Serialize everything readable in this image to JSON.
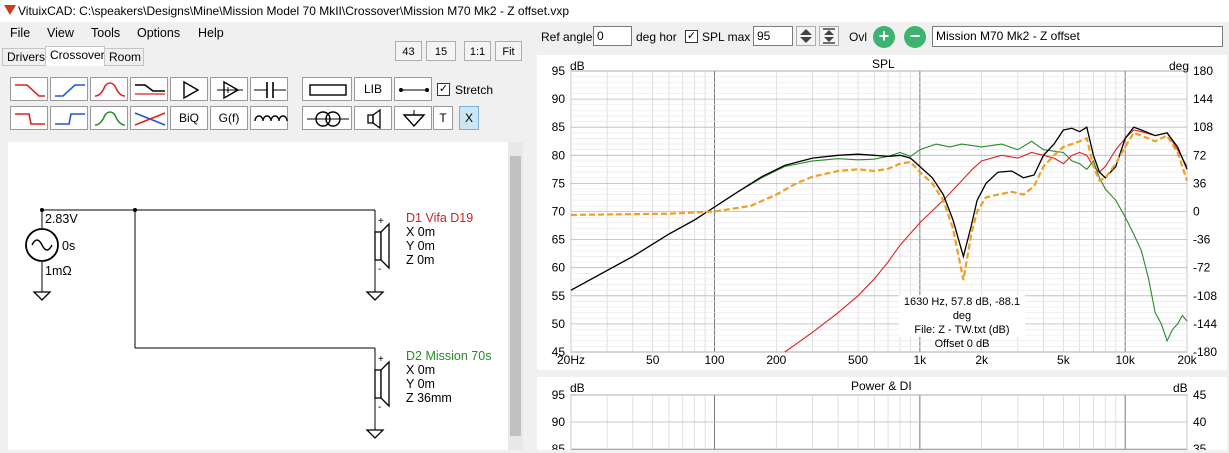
{
  "window": {
    "title": "VituixCAD: C:\\speakers\\Designs\\Mine\\Mission Model 70 MkII\\Crossover\\Mission M70 Mk2 - Z offset.vxp"
  },
  "menu": {
    "file": "File",
    "view": "View",
    "tools": "Tools",
    "options": "Options",
    "help": "Help"
  },
  "zoom_buttons": {
    "b43": "43",
    "b15": "15",
    "b11": "1:1",
    "fit": "Fit"
  },
  "tabs": {
    "drivers": "Drivers",
    "crossover": "Crossover",
    "room": "Room"
  },
  "toolbox": {
    "lib": "LIB",
    "biq": "BiQ",
    "gf": "G(f)",
    "t": "T",
    "x": "X",
    "stretch_label": "Stretch",
    "stretch_checked": true
  },
  "schematic": {
    "source": {
      "voltage": "2.83V",
      "delay": "0s",
      "resistance": "1mΩ"
    },
    "driver1": {
      "name": "D1 Vifa D19",
      "x": "X 0m",
      "y": "Y 0m",
      "z": "Z 0m",
      "color": "#cc2222"
    },
    "driver2": {
      "name": "D2 Mission 70s",
      "x": "X 0m",
      "y": "Y 0m",
      "z": "Z 36mm",
      "color": "#2a8a2a"
    }
  },
  "controls": {
    "ref_angle_label": "Ref angle",
    "ref_angle_value": "0",
    "deg_hor_label": "deg hor",
    "spl_max_label": "SPL max",
    "spl_max_checked": true,
    "spl_max_value": "95",
    "ovl_label": "Ovl",
    "overlay_name": "Mission M70 Mk2 - Z offset"
  },
  "spl_graph": {
    "title": "SPL",
    "y_left_unit": "dB",
    "y_right_unit": "deg",
    "y_left_ticks": [
      "95",
      "90",
      "85",
      "80",
      "75",
      "70",
      "65",
      "60",
      "55",
      "50",
      "45"
    ],
    "y_right_ticks": [
      "180",
      "144",
      "108",
      "72",
      "36",
      "0",
      "-36",
      "-72",
      "-108",
      "-144",
      "-180"
    ],
    "x_ticks": [
      "20Hz",
      "50",
      "100",
      "200",
      "500",
      "1k",
      "2k",
      "5k",
      "10k",
      "20k"
    ],
    "tooltip": {
      "line1": "1630 Hz, 57.8 dB, -88.1 deg",
      "line2": "File: Z - TW.txt (dB)",
      "line3": "Offset 0 dB"
    },
    "colors": {
      "total": "#000000",
      "tweeter": "#dd2222",
      "woofer": "#2a8a2a",
      "overlay": "#f0a020"
    }
  },
  "power_graph": {
    "title": "Power & DI",
    "y_left_unit": "dB",
    "y_right_unit": "dB",
    "y_left_ticks": [
      "95",
      "90",
      "85"
    ],
    "y_right_ticks": [
      "45",
      "40",
      "35"
    ]
  }
}
